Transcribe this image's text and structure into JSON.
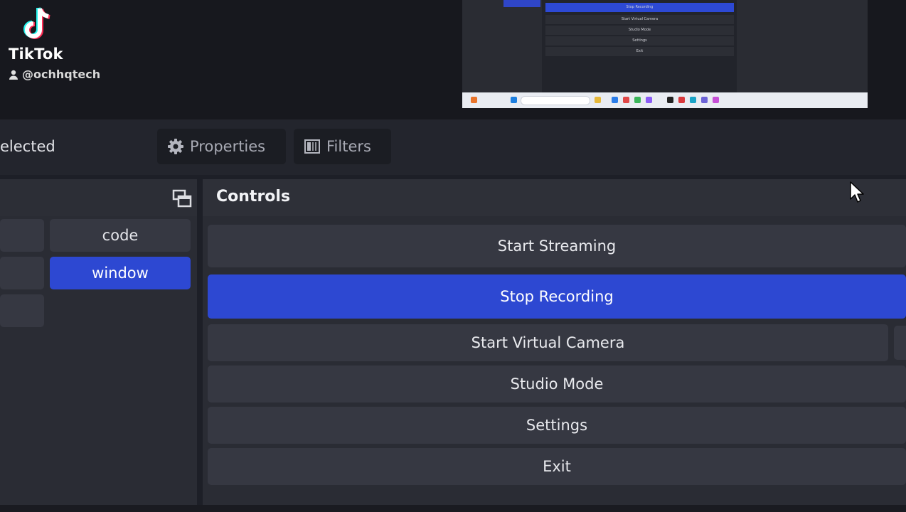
{
  "watermark": {
    "brand": "TikTok",
    "username": "@ochhqtech",
    "icon": "tiktok-logo-icon",
    "user_icon": "person-icon"
  },
  "preview": {
    "controls": [
      "Stop Recording",
      "Start Virtual Camera",
      "Studio Mode",
      "Settings",
      "Exit"
    ]
  },
  "toolbar": {
    "selection_label": "elected",
    "properties_label": "Properties",
    "properties_icon": "gear-icon",
    "filters_label": "Filters",
    "filters_icon": "filter-icon"
  },
  "sources_panel": {
    "undock_icon": "undock-icon",
    "buttons": [
      {
        "label": "",
        "selected": false
      },
      {
        "label": "code",
        "selected": false
      },
      {
        "label": "",
        "selected": false
      },
      {
        "label": "window",
        "selected": true
      },
      {
        "label": "",
        "selected": false
      }
    ]
  },
  "controls": {
    "title": "Controls",
    "start_streaming": "Start Streaming",
    "stop_recording": "Stop Recording",
    "start_virtual_camera": "Start Virtual Camera",
    "studio_mode": "Studio Mode",
    "settings": "Settings",
    "exit": "Exit"
  },
  "colors": {
    "accent": "#2d48d2",
    "background": "#1d1f27",
    "button": "#363842",
    "panel": "#2a2c34"
  }
}
